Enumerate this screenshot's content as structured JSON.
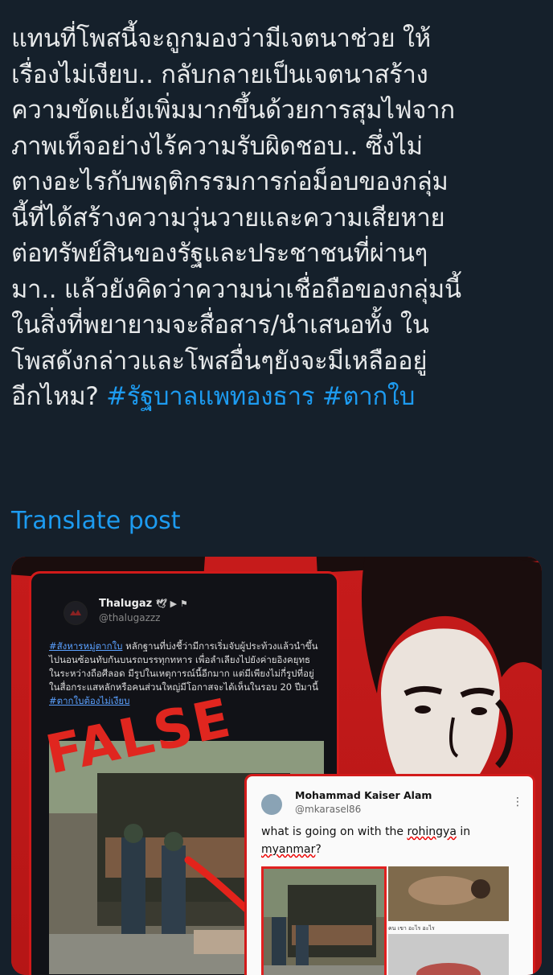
{
  "post": {
    "lines": [
      "แทนที่โพสนี้จะถูกมองว่ามีเจตนาช่วย ให้",
      "เรื่องไม่เงียบ.. กลับกลายเป็นเจตนาสร้าง",
      "ความขัดแย้งเพิ่มมากขึ้นด้วยการสุมไฟจาก",
      "ภาพเท็จอย่างไร้ความรับผิดชอบ.. ซึ่งไม่",
      "ตางอะไรกับพฤติกรรมการก่อม็อบของกลุ่ม",
      "นี้ที่ได้สร้างความวุ่นวายและความเสียหาย",
      "ต่อทรัพย์สินของรัฐและประชาชนที่ผ่านๆ",
      "มา.. แล้วยังคิดว่าความน่าเชื่อถือของกลุ่มนี้",
      "ในสิ่งที่พยายามจะสื่อสาร/นำเสนอทั้ง ใน",
      "โพสดังกล่าวและโพสอื่นๆยังจะมีเหลืออยู่"
    ],
    "last_line_text": "อีกไหม? ",
    "hashtag1": "#รัฐบาลแพทองธาร",
    "hashtag2": "#ตากใบ"
  },
  "translate_label": "Translate post",
  "media": {
    "false_label": "FALSE",
    "dark_card": {
      "name": "Thalugaz",
      "handle": "@thalugazzz",
      "tag1": "#สังหารหมู่ตากใบ",
      "text": " หลักฐานที่บ่งชี้ว่ามีการเริ่มจับผู้ประท้วงแล้วนำขึ้นไปนอนซ้อนทับกันบนรถบรรทุกทหาร เพื่อลำเลียงไปยังค่ายอิงคยุทธ ในระหว่างถือศีลอด มีรูปในเหตุการณ์นี้อีกมาก แต่มีเพียงไม่กี่รูปที่อยู่ในสื่อกระแสหลักหรือคนส่วนใหญ่มีโอกาสจะได้เห็นในรอบ 20 ปีมานี้ ",
      "tag2": "#ตากใบต้องไม่เงียบ"
    },
    "white_card": {
      "name": "Mohammad Kaiser Alam",
      "handle": "@mkarasel86",
      "more": "⋮",
      "text_a": "what is going on with the ",
      "text_b": "rohingya",
      "text_c": " in ",
      "text_d": "myanmar",
      "text_e": "?",
      "caption": "คน เขา อะไร อะไร"
    }
  },
  "colors": {
    "background": "#15202b",
    "text": "#e7e9ea",
    "link": "#1d9bf0",
    "alert_red": "#c61b1b"
  }
}
